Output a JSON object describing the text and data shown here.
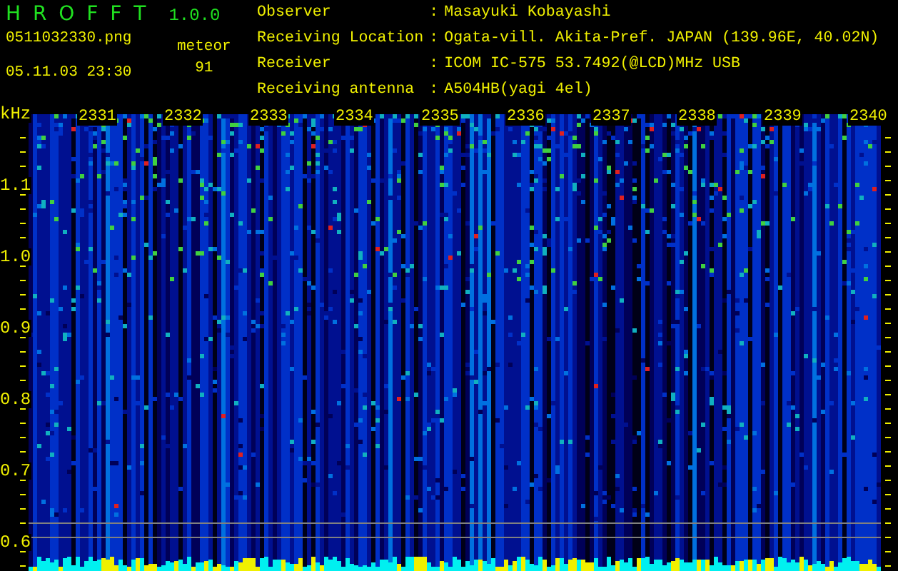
{
  "app": {
    "title": "H R O F F T",
    "version": "1.0.0"
  },
  "file": {
    "name": "0511032330.png",
    "datetime": "05.11.03 23:30"
  },
  "counter": {
    "label": "meteor",
    "value": "91"
  },
  "info": [
    {
      "label": "Observer",
      "separator": ":",
      "value": "Masayuki Kobayashi"
    },
    {
      "label": "Receiving Location",
      "separator": ":",
      "value": "Ogata-vill. Akita-Pref. JAPAN (139.96E, 40.02N)"
    },
    {
      "label": "Receiver",
      "separator": ":",
      "value": "ICOM IC-575 53.7492(@LCD)MHz USB"
    },
    {
      "label": "Receiving antenna",
      "separator": ":",
      "value": "A504HB(yagi 4el)"
    }
  ],
  "plot": {
    "unit": "kHz",
    "y_labels": [
      "1.1",
      "1.0",
      "0.9",
      "0.8",
      "0.7",
      "0.6"
    ],
    "time_labels": [
      "2331",
      "2332",
      "2333",
      "2334",
      "2335",
      "2336",
      "2337",
      "2338",
      "2339",
      "2340"
    ]
  }
}
